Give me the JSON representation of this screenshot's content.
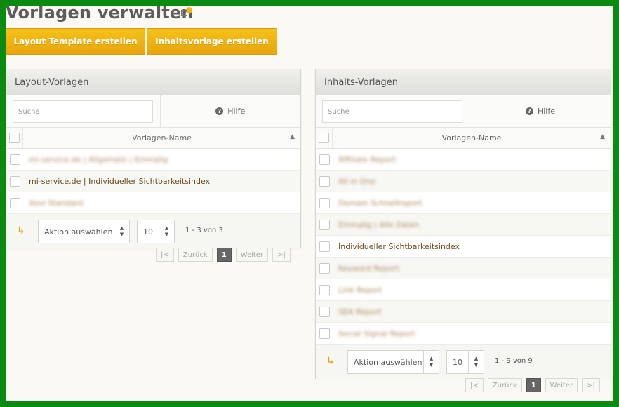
{
  "page": {
    "title": "Vorlagen verwalten"
  },
  "actions": {
    "create_layout_label": "Layout Template erstellen",
    "create_content_label": "Inhaltsvorlage erstellen"
  },
  "layout_panel": {
    "title": "Layout-Vorlagen",
    "search_placeholder": "Suche",
    "help_label": "Hilfe",
    "column_header": "Vorlagen-Name",
    "rows": [
      {
        "name": "mi-service.de | Allgemein | Einmalig",
        "blurred": true
      },
      {
        "name": "mi-service.de | Individueller Sichtbarkeitsindex",
        "blurred": false
      },
      {
        "name": "Xovi Standard",
        "blurred": true
      }
    ],
    "action_select": "Aktion auswählen",
    "page_size": "10",
    "range": "1 - 3 von 3",
    "pager": {
      "first": "|<",
      "prev": "Zurück",
      "current": "1",
      "next": "Weiter",
      "last": ">|"
    }
  },
  "content_panel": {
    "title": "Inhalts-Vorlagen",
    "search_placeholder": "Suche",
    "help_label": "Hilfe",
    "column_header": "Vorlagen-Name",
    "rows": [
      {
        "name": "Affiliate Report",
        "blurred": true
      },
      {
        "name": "All in One",
        "blurred": true
      },
      {
        "name": "Domain Schnellreport",
        "blurred": true
      },
      {
        "name": "Einmalig | Alle Daten",
        "blurred": true
      },
      {
        "name": "Individueller Sichtbarkeitsindex",
        "blurred": false
      },
      {
        "name": "Keyword Report",
        "blurred": true
      },
      {
        "name": "Link Report",
        "blurred": true
      },
      {
        "name": "SEA Report",
        "blurred": true
      },
      {
        "name": "Social Signal Report",
        "blurred": true
      }
    ],
    "action_select": "Aktion auswählen",
    "page_size": "10",
    "range": "1 - 9 von 9",
    "pager": {
      "first": "|<",
      "prev": "Zurück",
      "current": "1",
      "next": "Weiter",
      "last": ">|"
    }
  },
  "colors": {
    "accent": "#f0b414",
    "frame": "#0b8a12",
    "link_text": "#6b4a1e"
  },
  "icons": {
    "help": "help-circle-icon",
    "sort": "chevron-up-icon",
    "corner": "corner-arrow-icon"
  }
}
